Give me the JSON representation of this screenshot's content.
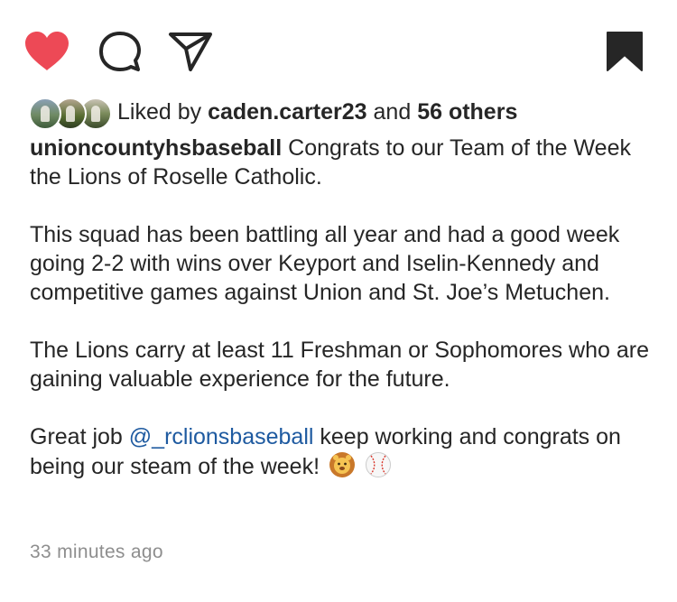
{
  "actions": {
    "like_icon": "heart-filled-icon",
    "comment_icon": "comment-bubble-icon",
    "share_icon": "paper-plane-icon",
    "save_icon": "bookmark-filled-icon",
    "like_color": "#ed4956"
  },
  "likes": {
    "prefix": "Liked by ",
    "user": "caden.carter23",
    "connector": " and ",
    "others": "56 others"
  },
  "caption": {
    "username": "unioncountyhsbaseball",
    "line1": " Congrats to our Team of the Week the Lions of Roselle Catholic.",
    "para2": "This squad has been battling all year and had a good week going 2-2 with wins over Keyport and Iselin-Kennedy and competitive games against Union and St. Joe’s Metuchen.",
    "para3": "The Lions carry at least 11 Freshman or Sophomores who are gaining valuable experience for the future.",
    "para4_before": "Great job ",
    "mention": "@_rclionsbaseball",
    "para4_after": " keep working and congrats on being our steam of the week!",
    "emoji_1": "lion-face-emoji",
    "emoji_2": "baseball-emoji"
  },
  "timestamp": "33 minutes ago"
}
